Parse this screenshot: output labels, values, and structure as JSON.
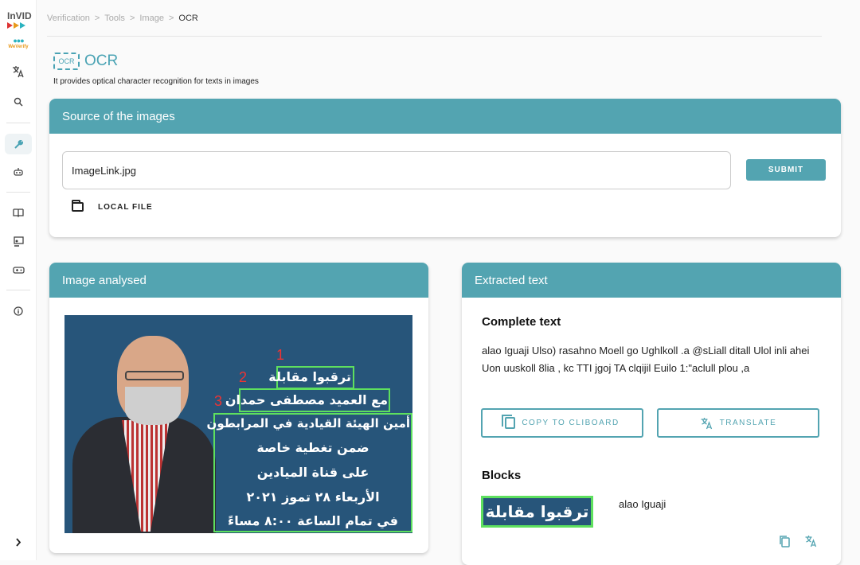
{
  "sidebar": {
    "logo_top": "InVID",
    "logo_bottom": "WeVerify",
    "icons": [
      "translate-icon",
      "search-icon",
      "wrench-icon",
      "robot-icon",
      "book-icon",
      "classroom-icon",
      "gamepad-icon",
      "info-icon",
      "chevron-right-icon"
    ]
  },
  "breadcrumb": [
    "Verification",
    "Tools",
    "Image",
    "OCR"
  ],
  "breadcrumb_separator": ">",
  "page": {
    "icon_label": "OCR",
    "title": "OCR",
    "subtitle": "It provides optical character recognition for texts in images"
  },
  "source_card": {
    "title": "Source of the images",
    "input_value": "ImageLink.jpg",
    "submit_label": "SUBMIT",
    "local_file_label": "LOCAL FILE"
  },
  "image_card": {
    "title": "Image analysed",
    "box_numbers": [
      "1",
      "2",
      "3"
    ],
    "arabic_lines": [
      "ترقبوا مقابلة",
      "مع العميد مصطفى حمدان",
      "أمين الهيئة القيادية في المرابطون",
      "ضمن تغطية خاصة",
      "على قناة الميادين",
      "الأربعاء ٢٨ تموز ٢٠٢١",
      "في تمام الساعة ٨:٠٠ مساءً"
    ]
  },
  "extracted_card": {
    "title": "Extracted text",
    "complete_heading": "Complete text",
    "complete_text": "alao Iguaji Ulso) rasahno Moell go Ughlkoll .a @sLiall ditall Ulol inli ahei Uon uuskoll 8lia , kc TTI jgoj TA clqijil Euilo 1:\"aclull plou ,a",
    "copy_label": "COPY TO CLIBOARD",
    "translate_label": "TRANSLATE",
    "blocks_heading": "Blocks",
    "block_image_text": "ترقبوا مقابلة",
    "block_text": "alao Iguaji"
  },
  "colors": {
    "accent": "#53a4b1",
    "ocr_box": "#5ee05e",
    "box_number": "#e33333",
    "image_bg": "#27557a"
  }
}
